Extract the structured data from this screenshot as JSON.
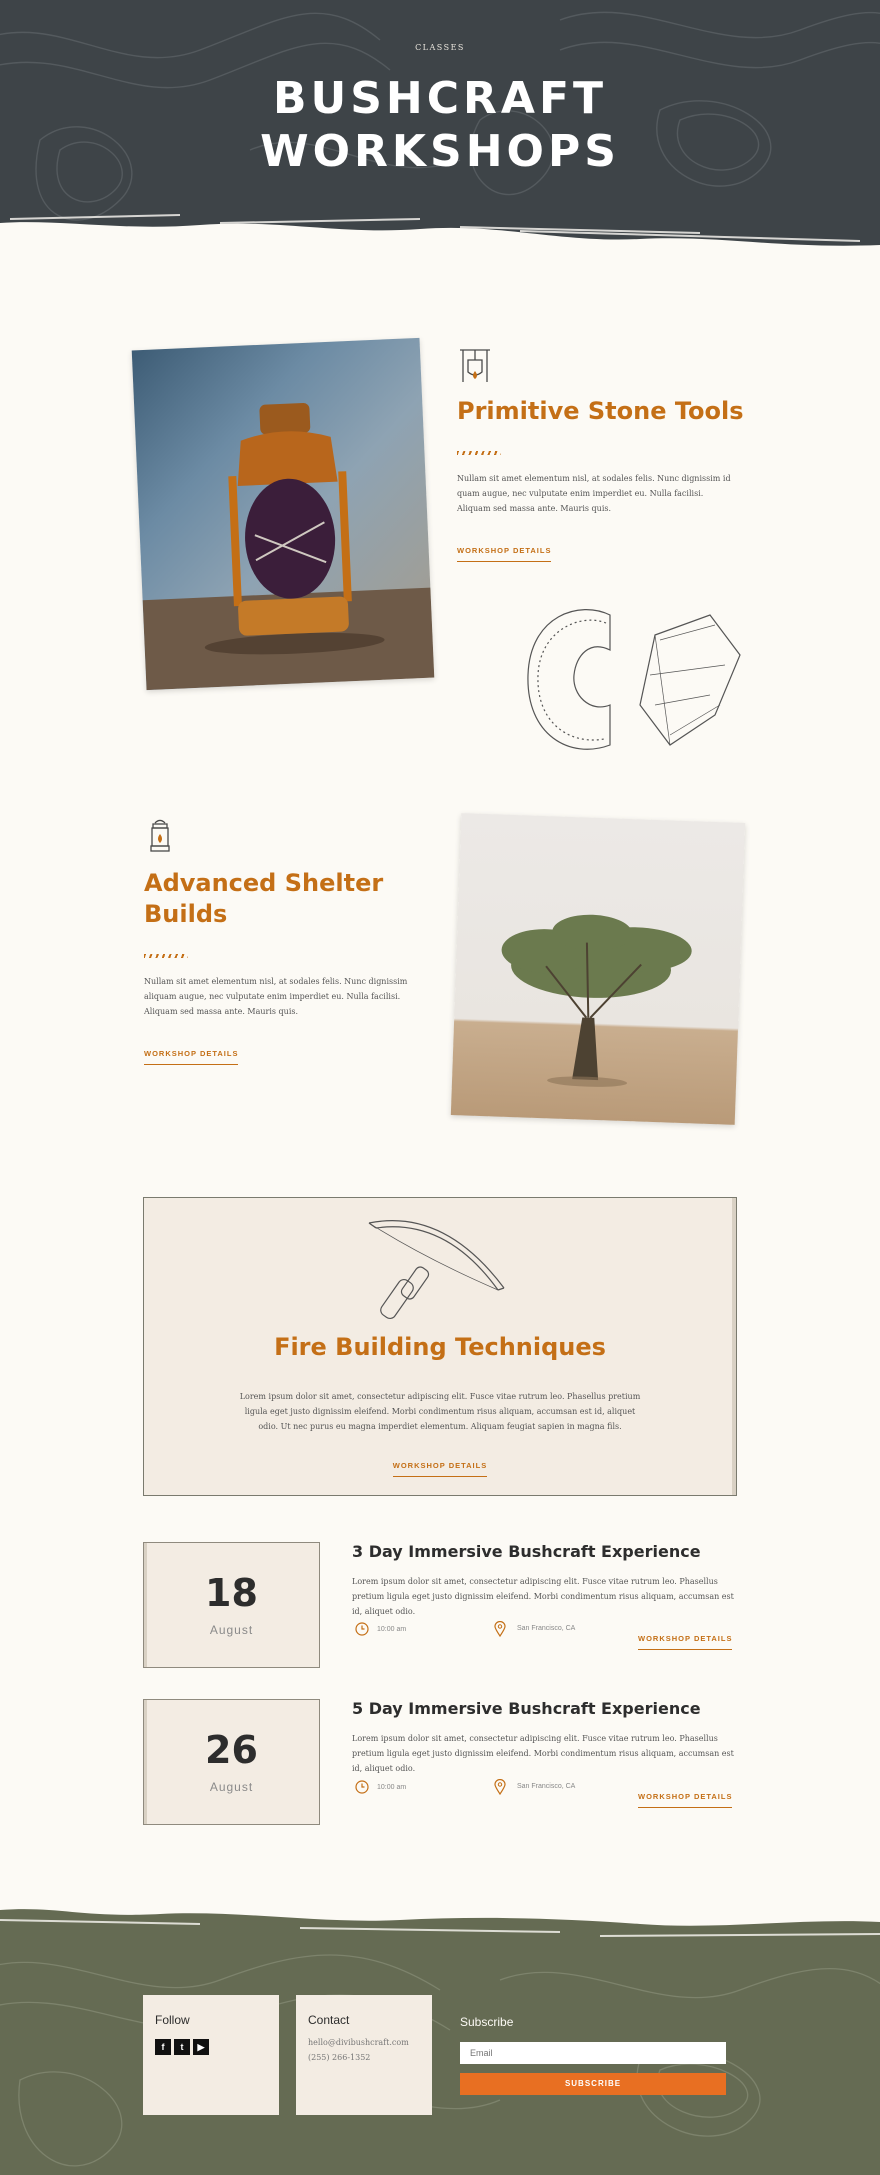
{
  "header": {
    "eyebrow": "CLASSES",
    "title_line1": "BUSHCRAFT",
    "title_line2": "WORKSHOPS"
  },
  "workshops": [
    {
      "title": "Primitive Stone Tools",
      "text": "Nullam sit amet elementum nisl, at sodales felis. Nunc dignissim id quam augue, nec vulputate enim imperdiet eu. Nulla facilisi. Aliquam sed massa ante. Mauris quis.",
      "cta": "WORKSHOP DETAILS",
      "icon": "stove-pot-icon"
    },
    {
      "title_line1": "Advanced Shelter",
      "title_line2": "Builds",
      "text": "Nullam sit amet elementum nisl, at sodales felis. Nunc dignissim aliquam augue, nec vulputate enim imperdiet eu. Nulla facilisi. Aliquam sed massa ante. Mauris quis.",
      "cta": "WORKSHOP DETAILS",
      "icon": "lantern-icon"
    },
    {
      "title": "Fire Building Techniques",
      "text": "Lorem ipsum dolor sit amet, consectetur adipiscing elit. Fusce vitae rutrum leo. Phasellus pretium ligula eget justo dignissim eleifend. Morbi condimentum risus aliquam, accumsan est id, aliquet odio. Ut nec purus eu magna imperdiet elementum. Aliquam feugiat sapien in magna fils.",
      "cta": "WORKSHOP DETAILS",
      "icon": "bow-drill-icon"
    }
  ],
  "events": [
    {
      "day": "18",
      "month": "August",
      "title": "3 Day Immersive Bushcraft Experience",
      "text": "Lorem ipsum dolor sit amet, consectetur adipiscing elit. Fusce vitae rutrum leo. Phasellus pretium ligula eget justo dignissim eleifend. Morbi condimentum risus aliquam, accumsan est id, aliquet odio.",
      "time": "10:00 am",
      "location": "San Francisco, CA",
      "cta": "WORKSHOP DETAILS"
    },
    {
      "day": "26",
      "month": "August",
      "title": "5 Day Immersive Bushcraft Experience",
      "text": "Lorem ipsum dolor sit amet, consectetur adipiscing elit. Fusce vitae rutrum leo. Phasellus pretium ligula eget justo dignissim eleifend. Morbi condimentum risus aliquam, accumsan est id, aliquet odio.",
      "time": "10:00 am",
      "location": "San Francisco, CA",
      "cta": "WORKSHOP DETAILS"
    }
  ],
  "footer": {
    "follow_title": "Follow",
    "social": [
      "f",
      "t",
      "▶"
    ],
    "contact_title": "Contact",
    "email": "hello@divibushcraft.com",
    "phone": "(255) 266-1352",
    "subscribe_title": "Subscribe",
    "email_placeholder": "Email",
    "subscribe_button": "SUBSCRIBE"
  },
  "colors": {
    "accent": "#c46f16",
    "header_bg": "#3e4448",
    "footer_bg": "#656b53",
    "button": "#e86f22"
  }
}
